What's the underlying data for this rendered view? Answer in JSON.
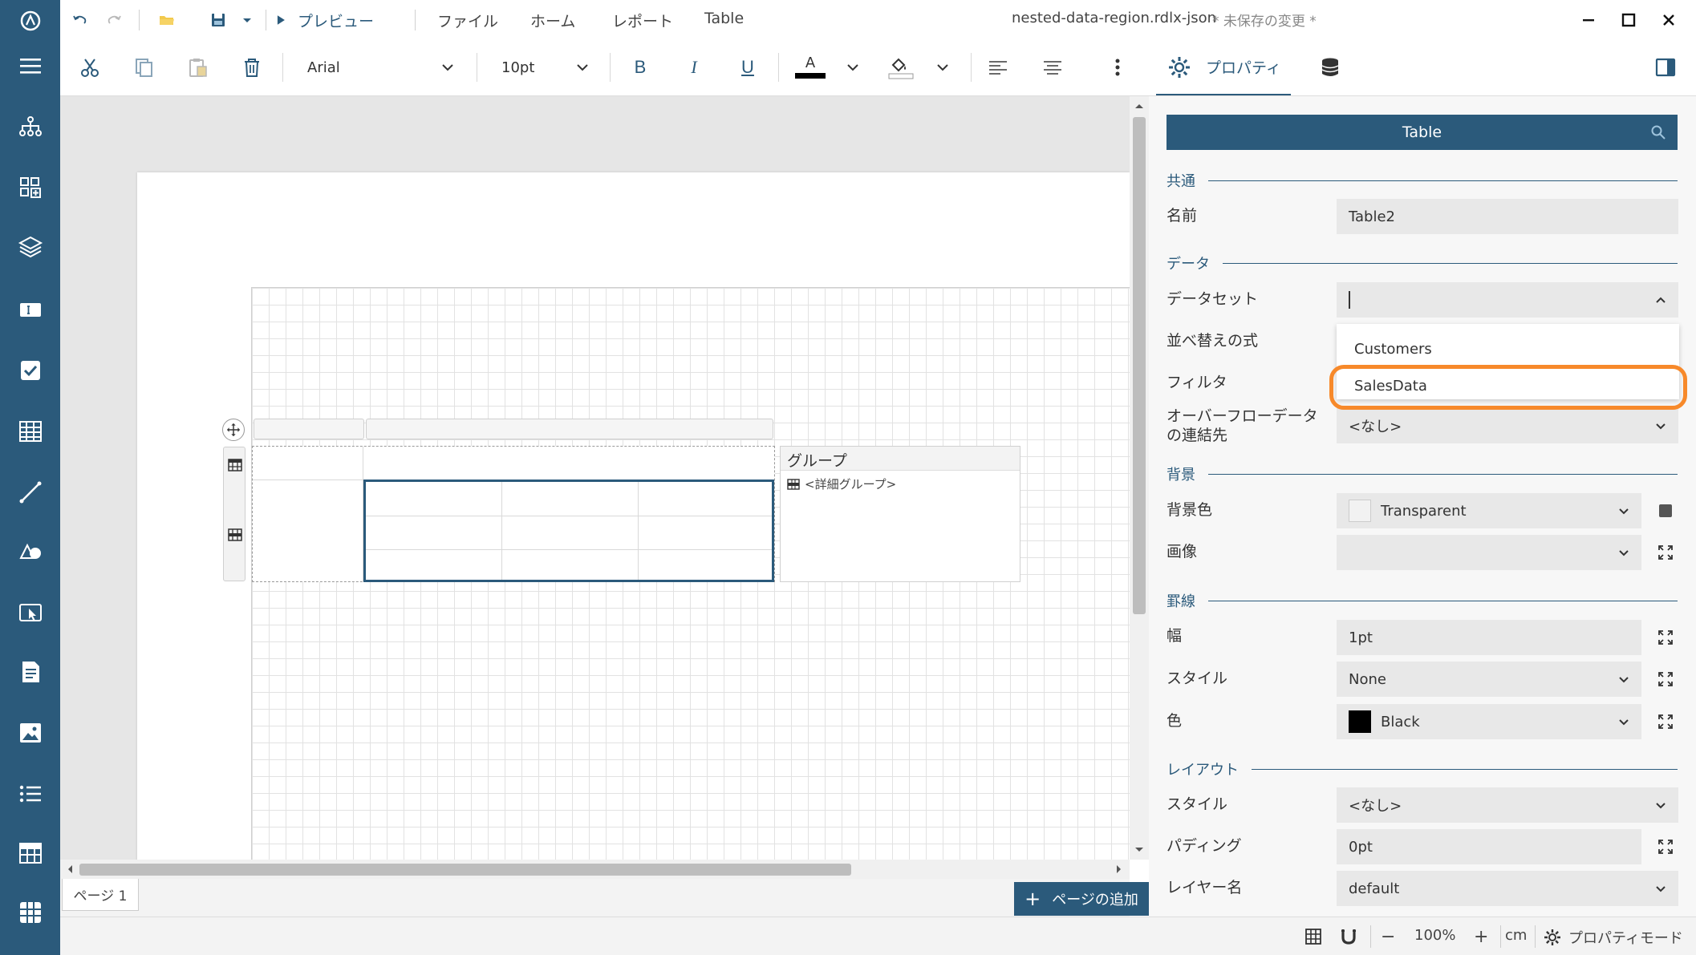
{
  "titlebar": {
    "preview_label": "プレビュー",
    "menu": [
      "ファイル",
      "ホーム",
      "レポート",
      "Table"
    ],
    "document_name": "nested-data-region.rdlx-json",
    "unsaved_label": "* 未保存の変更 *"
  },
  "toolbar": {
    "font_family": "Arial",
    "font_size": "10pt",
    "bold": "B",
    "italic": "I",
    "underline": "U",
    "font_color_glyph": "A",
    "properties_tab": "プロパティ"
  },
  "canvas": {
    "group_panel_title": "グループ",
    "detail_group": "<詳細グループ>",
    "page_tab": "ページ 1",
    "add_page": "ページの追加"
  },
  "panel": {
    "header": "Table",
    "sections": {
      "common": "共通",
      "data": "データ",
      "background": "背景",
      "border": "罫線",
      "layout": "レイアウト"
    },
    "properties": {
      "name_label": "名前",
      "name_value": "Table2",
      "dataset_label": "データセット",
      "sort_label": "並べ替えの式",
      "filter_label": "フィルタ",
      "overflow_label_1": "オーバーフローデータ",
      "overflow_label_2": "の連結先",
      "overflow_value": "<なし>",
      "bgcolor_label": "背景色",
      "bgcolor_value": "Transparent",
      "image_label": "画像",
      "width_label": "幅",
      "width_value": "1pt",
      "style_label": "スタイル",
      "style_value": "None",
      "color_label": "色",
      "color_value": "Black",
      "layout_style_label": "スタイル",
      "layout_style_value": "<なし>",
      "padding_label": "パディング",
      "padding_value": "0pt",
      "layer_label": "レイヤー名",
      "layer_value": "default"
    },
    "dataset_options": [
      "Customers",
      "SalesData"
    ]
  },
  "statusbar": {
    "zoom_minus": "−",
    "zoom_value": "100%",
    "zoom_plus": "+",
    "unit": "cm",
    "mode": "プロパティモード"
  },
  "colors": {
    "accent": "#2b5a7b",
    "highlight": "#f7892a",
    "black_swatch": "#000000"
  }
}
